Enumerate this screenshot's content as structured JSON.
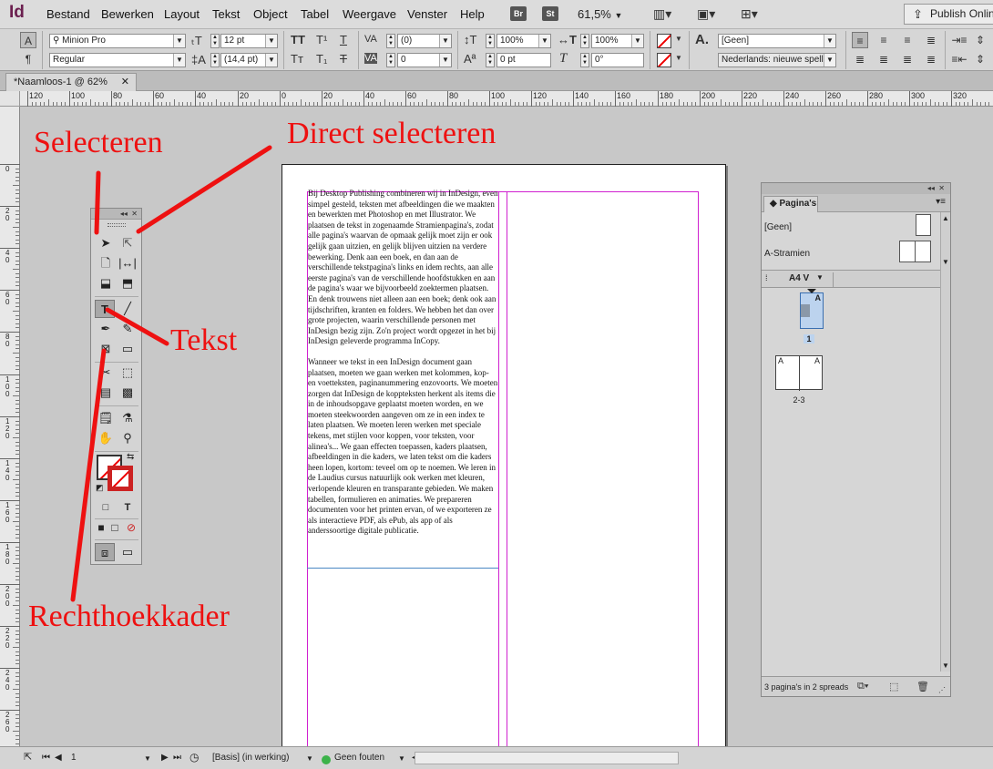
{
  "app": {
    "logo": "Id",
    "menu": [
      "Bestand",
      "Bewerken",
      "Layout",
      "Tekst",
      "Object",
      "Tabel",
      "Weergave",
      "Venster",
      "Help"
    ],
    "badges": [
      "Br",
      "St"
    ],
    "zoom": "61,5%",
    "publish_label": "Publish Online"
  },
  "control": {
    "font_family": "Minion Pro",
    "font_style": "Regular",
    "font_size": "12 pt",
    "leading": "(14,4 pt)",
    "kerning": "(0)",
    "tracking": "0",
    "vscale": "100%",
    "hscale": "100%",
    "baseline": "0 pt",
    "skew": "0°",
    "char_style": "[Geen]",
    "language": "Nederlands: nieuwe spell..."
  },
  "document": {
    "tab_title": "*Naamloos-1 @ 62%"
  },
  "ruler": {
    "h_labels": [
      "120",
      "100",
      "80",
      "60",
      "40",
      "20",
      "0",
      "20",
      "40",
      "60",
      "80",
      "100",
      "120",
      "140",
      "160",
      "180",
      "200",
      "220",
      "240",
      "260",
      "280",
      "300",
      "320"
    ],
    "v_labels": [
      "0",
      "20",
      "40",
      "60",
      "80",
      "100",
      "120",
      "140",
      "160",
      "180",
      "200",
      "220",
      "240",
      "260"
    ]
  },
  "page_text": {
    "paragraph1": "Bij Desktop Publishing combineren wij in InDesign, even simpel gesteld, teksten met afbeeldingen die we maakten en bewerkten met Photoshop en met Illustrator. We plaatsen de tekst in zogenaamde Stramienpagina's, zodat alle pagina's waarvan de opmaak gelijk moet zijn er ook gelijk gaan uitzien, en gelijk blijven uitzien na verdere bewerking. Denk aan een boek, en dan aan de verschillende tekstpagina's links en idem rechts, aan alle eerste pagina's van de verschillende hoofdstukken en aan de pagina's waar we bijvoorbeeld zoektermen plaatsen. En denk trouwens niet alleen aan een boek; denk ook aan tijdschriften, kranten en folders. We hebben het dan over grote projecten, waarin verschillende personen met InDesign bezig zijn. Zo'n project wordt opgezet in het bij InDesign geleverde programma InCopy.",
    "paragraph2": "Wanneer we tekst in een InDesign document gaan plaatsen, moeten we gaan werken met kolommen, kop- en voetteksten, paginanummering enzovoorts. We moeten zorgen dat InDesign de koppteksten herkent als items die in de inhoudsopgave geplaatst moeten worden, en we moeten steekwoorden aangeven om ze in een index te laten plaatsen. We moeten leren werken met speciale tekens, met stijlen voor koppen, voor teksten, voor alinea's... We gaan effecten toepassen, kaders plaatsen, afbeeldingen in die kaders, we laten tekst om die kaders heen lopen, kortom: teveel om op te noemen. We leren in de Laudius cursus natuurlijk ook werken met kleuren, verlopende kleuren en transparante gebieden. We maken tabellen, formulieren en animaties. We prepareren documenten voor het printen ervan, of we exporteren ze als interactieve PDF, als ePub, als app of als anderssoortige digitale publicatie."
  },
  "pages_panel": {
    "title": "Pagina's",
    "master_none": "[Geen]",
    "master_a": "A-Stramien",
    "page_size": "A4 V",
    "spread1_label": "1",
    "spread2_label": "2-3",
    "master_prefix": "A",
    "footer_count": "3 pagina's in 2 spreads"
  },
  "status": {
    "page_number": "1",
    "profile": "[Basis] (in werking)",
    "preflight": "Geen fouten"
  },
  "annotations": {
    "selecteren": "Selecteren",
    "direct_selecteren": "Direct selecteren",
    "tekst": "Tekst",
    "rechthoekkader": "Rechthoekkader"
  },
  "colors": {
    "annotation": "#ee1111",
    "margin_guide": "#d020d0",
    "preflight_ok": "#3cb34a",
    "app_logo": "#6b1f4f"
  },
  "icons": {
    "tools": [
      "selection-tool-icon",
      "direct-selection-tool-icon",
      "page-tool-icon",
      "gap-tool-icon",
      "content-collector-icon",
      "content-placer-icon",
      "type-tool-icon",
      "line-tool-icon",
      "pen-tool-icon",
      "pencil-tool-icon",
      "rectangle-frame-tool-icon",
      "rectangle-tool-icon",
      "scissors-tool-icon",
      "free-transform-tool-icon",
      "gradient-swatch-tool-icon",
      "gradient-feather-tool-icon",
      "note-tool-icon",
      "eyedropper-tool-icon",
      "hand-tool-icon",
      "zoom-tool-icon"
    ]
  }
}
